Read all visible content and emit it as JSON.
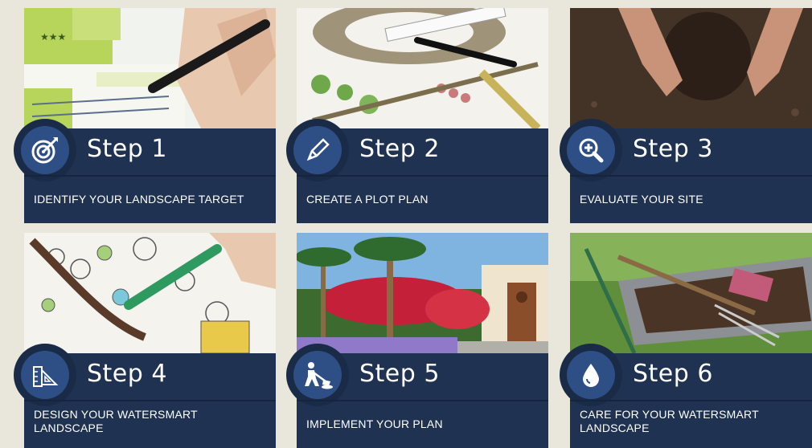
{
  "steps": [
    {
      "title": "Step 1",
      "caption": "IDENTIFY YOUR LANDSCAPE TARGET",
      "icon": "target-icon"
    },
    {
      "title": "Step 2",
      "caption": "CREATE A PLOT PLAN",
      "icon": "pencil-icon"
    },
    {
      "title": "Step 3",
      "caption": "EVALUATE YOUR SITE",
      "icon": "magnifier-plus-icon"
    },
    {
      "title": "Step 4",
      "caption": "DESIGN YOUR WATERSMART LANDSCAPE",
      "icon": "ruler-triangle-icon"
    },
    {
      "title": "Step 5",
      "caption": "IMPLEMENT YOUR PLAN",
      "icon": "worker-shovel-icon"
    },
    {
      "title": "Step 6",
      "caption": "CARE FOR YOUR WATERSMART LANDSCAPE",
      "icon": "water-drop-icon"
    }
  ],
  "colors": {
    "card": "#1f3251",
    "icon_disc": "#2e4f86",
    "background": "#e9e6dc"
  }
}
